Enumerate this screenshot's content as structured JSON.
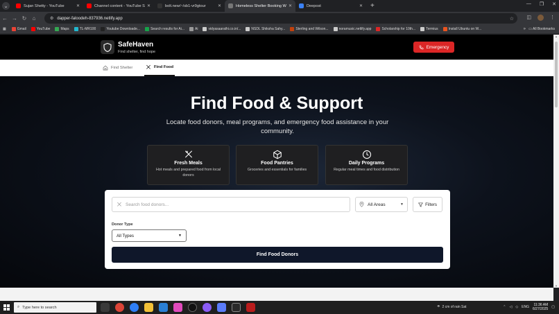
{
  "browser": {
    "tabs": [
      {
        "title": "Sujan Shetty - YouTube",
        "favicon_color": "#ff0000",
        "active": false
      },
      {
        "title": "Channel content - YouTube Stu",
        "favicon_color": "#ff0000",
        "active": false
      },
      {
        "title": "bolt.new/~/sb1-vr9gtour",
        "favicon_color": "#333333",
        "active": false
      },
      {
        "title": "Homeless Shelter Booking Web",
        "favicon_color": "#777777",
        "active": true
      },
      {
        "title": "Deepost",
        "favicon_color": "#3b82f6",
        "active": false
      }
    ],
    "new_tab": "+",
    "address": "dapper-faloodeh-837936.netlify.app",
    "bookmarks": [
      {
        "label": "Gmail",
        "color": "#ea4335"
      },
      {
        "label": "YouTube",
        "color": "#ff0000"
      },
      {
        "label": "Maps",
        "color": "#34a853"
      },
      {
        "label": "TL-MR100",
        "color": "#22b8cf"
      },
      {
        "label": "Youtube Downloade...",
        "color": "#222222"
      },
      {
        "label": "Search results for Ai...",
        "color": "#16a34a"
      },
      {
        "label": "Ai",
        "color": "#999999"
      },
      {
        "label": "vidyasaarathi.co.in/...",
        "color": "#cccccc"
      },
      {
        "label": "NSDL Shiksha Sahy...",
        "color": "#cccccc"
      },
      {
        "label": "Sterling and Wilson...",
        "color": "#c2410c"
      },
      {
        "label": "noramusic.netlify.app",
        "color": "#cccccc"
      },
      {
        "label": "Scholarship for 10th...",
        "color": "#dc2626"
      },
      {
        "label": "Termius",
        "color": "#cccccc"
      },
      {
        "label": "Install Ubuntu on W...",
        "color": "#e95420"
      }
    ],
    "bookmarks_more": "»",
    "all_bookmarks": "All Bookmarks"
  },
  "site": {
    "brand": "SafeHaven",
    "tagline": "Find shelter, find hope",
    "emergency_label": "Emergency",
    "nav": [
      {
        "label": "Find Shelter",
        "active": false
      },
      {
        "label": "Find Food",
        "active": true
      }
    ],
    "hero_title": "Find Food & Support",
    "hero_subtitle": "Locate food donors, meal programs, and emergency food assistance in your community.",
    "cards": [
      {
        "icon": "utensils-icon",
        "title": "Fresh Meals",
        "desc": "Hot meals and prepared food from local donors"
      },
      {
        "icon": "package-icon",
        "title": "Food Pantries",
        "desc": "Groceries and essentials for families"
      },
      {
        "icon": "clock-icon",
        "title": "Daily Programs",
        "desc": "Regular meal times and food distribution"
      }
    ],
    "search_placeholder": "Search food donors...",
    "area_value": "All Areas",
    "filters_label": "Filters",
    "donor_type_label": "Donor Type",
    "donor_type_value": "All Types",
    "find_button": "Find Food Donors"
  },
  "taskbar": {
    "search_placeholder": "Type here to search",
    "weather": "2 cm of rain Sat",
    "language": "ENG",
    "time": "11:36 AM",
    "date": "6/27/2025"
  },
  "colors": {
    "accent_red": "#dc2626",
    "button_dark": "#0f172a"
  }
}
